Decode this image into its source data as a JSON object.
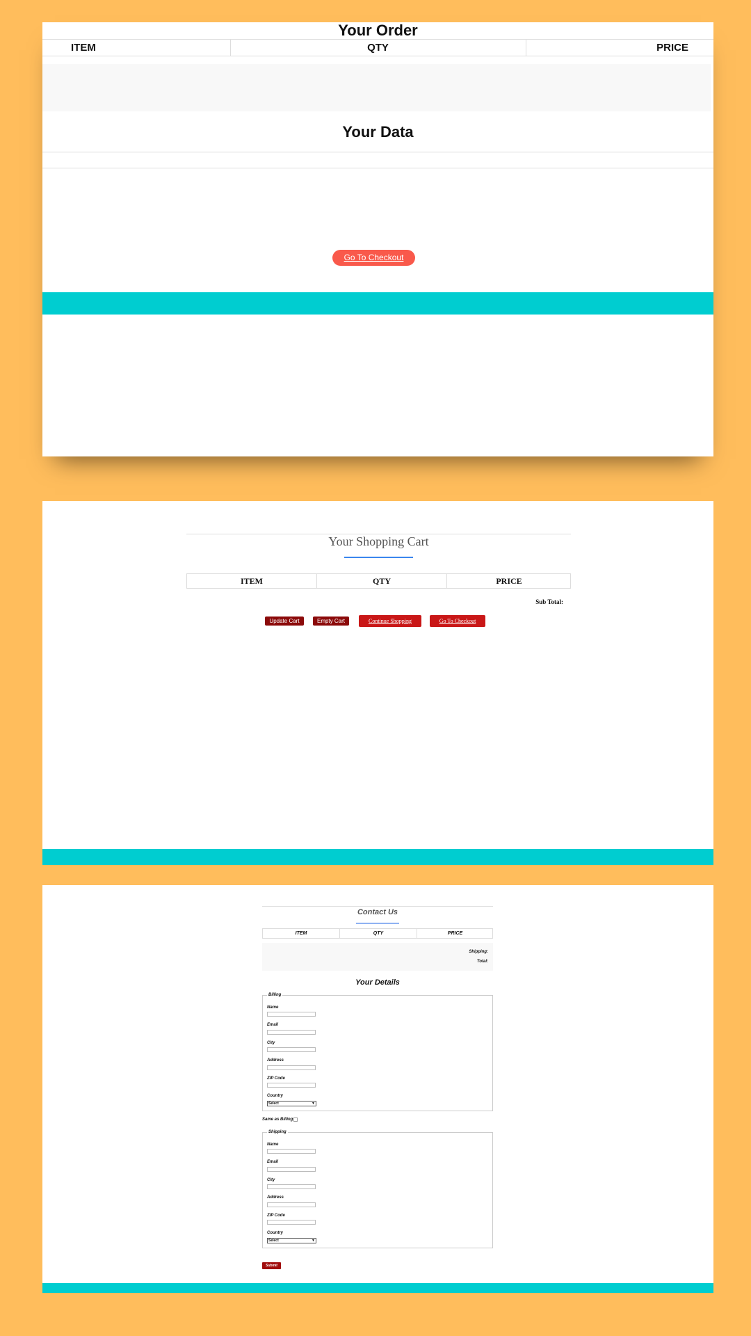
{
  "panel1": {
    "title": "Your Order",
    "columns": [
      "ITEM",
      "QTY",
      "PRICE"
    ],
    "subtitle": "Your Data",
    "checkout_label": "Go To Checkout"
  },
  "panel2": {
    "title": "Your Shopping Cart",
    "columns": [
      "ITEM",
      "QTY",
      "PRICE"
    ],
    "subtotal_label": "Sub Total:",
    "buttons": {
      "update": "Update Cart",
      "empty": "Empty Cart",
      "continue": "Continue Shopping",
      "checkout": "Go To Checkout"
    }
  },
  "panel3": {
    "title": "Contact Us",
    "columns": [
      "ITEM",
      "QTY",
      "PRICE"
    ],
    "shipping_label": "Shipping:",
    "total_label": "Total:",
    "details_title": "Your Details",
    "billing": {
      "legend": "Billing",
      "name": "Name",
      "email": "Email",
      "city": "City",
      "address": "Address",
      "zip": "ZIP Code",
      "country": "Country",
      "country_value": "Select"
    },
    "same_as_billing": "Same as Billing",
    "shipping": {
      "legend": "Shipping",
      "name": "Name",
      "email": "Email",
      "city": "City",
      "address": "Address",
      "zip": "ZIP Code",
      "country": "Country",
      "country_value": "Select"
    },
    "submit_label": "Submit"
  },
  "colors": {
    "background": "#ffbd5c",
    "teal": "#00cdd0",
    "checkout_orange": "#f9594b",
    "dark_red": "#8b0a0a",
    "red": "#c91717"
  }
}
